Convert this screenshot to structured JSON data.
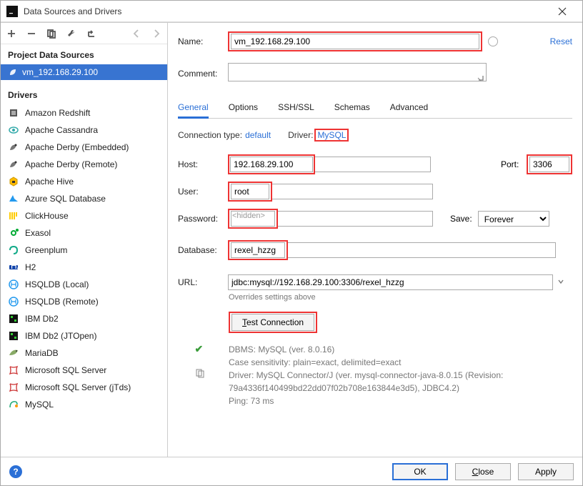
{
  "window": {
    "title": "Data Sources and Drivers"
  },
  "sidebar": {
    "sections": {
      "project": "Project Data Sources",
      "drivers": "Drivers"
    },
    "dataSources": [
      {
        "name": "vm_192.168.29.100"
      }
    ],
    "drivers": [
      {
        "name": "Amazon Redshift"
      },
      {
        "name": "Apache Cassandra"
      },
      {
        "name": "Apache Derby (Embedded)"
      },
      {
        "name": "Apache Derby (Remote)"
      },
      {
        "name": "Apache Hive"
      },
      {
        "name": "Azure SQL Database"
      },
      {
        "name": "ClickHouse"
      },
      {
        "name": "Exasol"
      },
      {
        "name": "Greenplum"
      },
      {
        "name": "H2"
      },
      {
        "name": "HSQLDB (Local)"
      },
      {
        "name": "HSQLDB (Remote)"
      },
      {
        "name": "IBM Db2"
      },
      {
        "name": "IBM Db2 (JTOpen)"
      },
      {
        "name": "MariaDB"
      },
      {
        "name": "Microsoft SQL Server"
      },
      {
        "name": "Microsoft SQL Server (jTds)"
      },
      {
        "name": "MySQL"
      }
    ]
  },
  "form": {
    "name_label": "Name:",
    "name_value": "vm_192.168.29.100",
    "reset": "Reset",
    "comment_label": "Comment:",
    "comment_value": "",
    "tabs": {
      "general": "General",
      "options": "Options",
      "sshssl": "SSH/SSL",
      "schemas": "Schemas",
      "advanced": "Advanced"
    },
    "conn_type_label": "Connection type:",
    "conn_type_value": "default",
    "driver_label": "Driver:",
    "driver_value": "MySQL",
    "host_label": "Host:",
    "host_value": "192.168.29.100",
    "port_label": "Port:",
    "port_value": "3306",
    "user_label": "User:",
    "user_value": "root",
    "password_label": "Password:",
    "password_placeholder": "<hidden>",
    "save_label": "Save:",
    "save_value": "Forever",
    "database_label": "Database:",
    "database_value": "rexel_hzzg",
    "url_label": "URL:",
    "url_value": "jdbc:mysql://192.168.29.100:3306/rexel_hzzg",
    "overrides": "Overrides settings above",
    "test_connection": "Test Connection",
    "result": {
      "line1": "DBMS: MySQL (ver. 8.0.16)",
      "line2": "Case sensitivity: plain=exact, delimited=exact",
      "line3": "Driver: MySQL Connector/J (ver. mysql-connector-java-8.0.15 (Revision: 79a4336f140499bd22dd07f02b708e163844e3d5), JDBC4.2)",
      "line4": "Ping: 73 ms"
    }
  },
  "footer": {
    "ok": "OK",
    "close": "Close",
    "apply": "Apply",
    "help": "?"
  }
}
